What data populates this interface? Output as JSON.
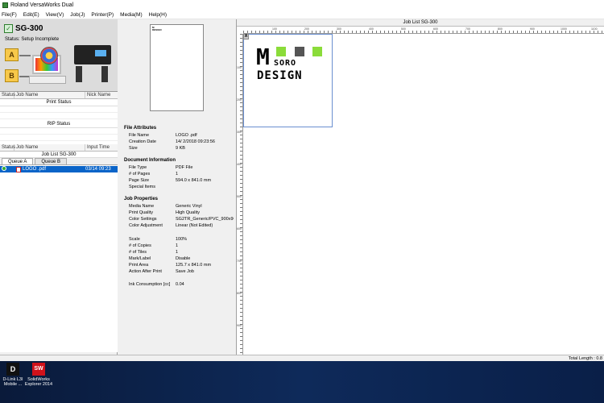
{
  "window": {
    "title": "Roland VersaWorks Dual"
  },
  "menu": [
    "File(F)",
    "Edit(E)",
    "View(V)",
    "Job(J)",
    "Printer(P)",
    "Media(M)",
    "Help(H)"
  ],
  "printer": {
    "name": "SG-300",
    "status": "Status: Setup Incomplete",
    "queue_a": "A",
    "queue_b": "B"
  },
  "print_list": {
    "columns": [
      "Status",
      "Job Name",
      "Nick Name"
    ],
    "label": "Print Status"
  },
  "rip_list": {
    "label": "RIP Status"
  },
  "job_list": {
    "columns": [
      "Status",
      "Job Name",
      "Input Time"
    ],
    "label": "Job List SG-300",
    "tabs": [
      "Queue A",
      "Queue B"
    ],
    "jobs": [
      {
        "name": "LOGO .pdf",
        "time": "03/14 09:23"
      }
    ]
  },
  "preview": {
    "thumb_text": "M DESIGN"
  },
  "file_attributes": {
    "title": "File Attributes",
    "rows": [
      {
        "key": "File Name",
        "value": "LOGO .pdf"
      },
      {
        "key": "Creation Date",
        "value": "14/ 2/2018 09:23:56"
      },
      {
        "key": "Size",
        "value": "9 KB"
      }
    ]
  },
  "document_info": {
    "title": "Document Information",
    "rows": [
      {
        "key": "File Type",
        "value": "PDF File"
      },
      {
        "key": "# of Pages",
        "value": "1"
      },
      {
        "key": "Page Size",
        "value": "594.0 x 841.0 mm"
      },
      {
        "key": "Special Items",
        "value": ""
      }
    ]
  },
  "job_properties": {
    "title": "Job Properties",
    "rows": [
      {
        "key": "Media Name",
        "value": "Generic Vinyl"
      },
      {
        "key": "Print Quality",
        "value": "High Quality"
      },
      {
        "key": "Color Settings",
        "value": "SG2TR_Generic/PVC_900x900 (..."
      },
      {
        "key": "Color Adjustment",
        "value": "Linear (Not Edited)"
      }
    ],
    "rows2": [
      {
        "key": "Scale",
        "value": "100%"
      },
      {
        "key": "# of Copies",
        "value": "1"
      },
      {
        "key": "# of Tiles",
        "value": "1"
      },
      {
        "key": "Mark/Label",
        "value": "Disable"
      },
      {
        "key": "Print Area",
        "value": "125.7 x 841.0 mm"
      },
      {
        "key": "Action After Print",
        "value": "Save Job"
      }
    ],
    "ink": {
      "key": "Ink Consumption [cc]",
      "value": "0.04"
    }
  },
  "right_panel": {
    "title": "Job List SG-300",
    "page_badge": "A",
    "logo": {
      "m": "M",
      "word1": "SORO",
      "word2": "DESIGN",
      "colors": [
        "#8bdc3a",
        "#555555",
        "#8bdc3a"
      ]
    },
    "ruler_h": [
      "100",
      "200",
      "300",
      "400",
      "500",
      "600",
      "700",
      "800",
      "900",
      "1000",
      "1100"
    ],
    "ruler_v": [
      "100",
      "200",
      "300",
      "400",
      "500",
      "600",
      "700",
      "800",
      "900"
    ]
  },
  "status": {
    "total_length": "Total Length : 0.8"
  },
  "desktop": [
    {
      "label1": "D-Link L3I",
      "label2": "Mobile ...",
      "icon": "D"
    },
    {
      "label1": "SolidWorks",
      "label2": "Explorer 2014",
      "icon": "SW"
    }
  ],
  "colors": {
    "selection": "#0a64c8",
    "desktop": "#0e2a5a"
  }
}
